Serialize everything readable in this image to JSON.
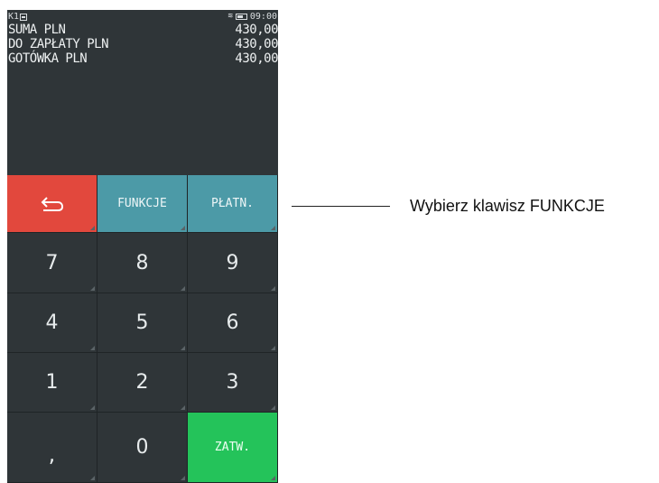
{
  "status": {
    "left": "K1",
    "time": "09:00",
    "printer_icon": "printer-icon",
    "wifi_icon": "wifi-icon",
    "battery_icon": "battery-icon"
  },
  "display_lines": [
    {
      "label": "SUMA PLN",
      "value": "430,00"
    },
    {
      "label": "DO ZAPŁATY PLN",
      "value": "430,00"
    },
    {
      "label": "GOTÓWKA PLN",
      "value": "430,00"
    }
  ],
  "keys": {
    "back_icon": "back-arrow-icon",
    "funkcje": "FUNKCJE",
    "platn": "PŁATN.",
    "k7": "7",
    "k8": "8",
    "k9": "9",
    "k4": "4",
    "k5": "5",
    "k6": "6",
    "k1": "1",
    "k2": "2",
    "k3": "3",
    "comma": ",",
    "k0": "0",
    "zatw": "ZATW."
  },
  "callout": {
    "text": "Wybierz klawisz FUNKCJE"
  },
  "colors": {
    "red": "#e2483d",
    "teal": "#4c9aa7",
    "green": "#24c35a",
    "dark": "#2f3538"
  }
}
